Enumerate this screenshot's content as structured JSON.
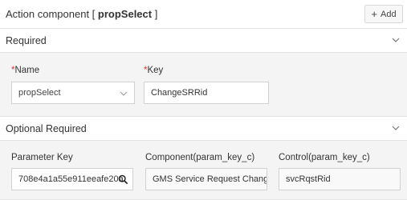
{
  "header": {
    "title_prefix": "Action component [ ",
    "title_name": "propSelect",
    "title_suffix": " ]",
    "add_label": "Add"
  },
  "required_section": {
    "label": "Required",
    "name_label": "Name",
    "name_value": "propSelect",
    "key_label": "Key",
    "key_value": "ChangeSRRid"
  },
  "optional_section": {
    "label": "Optional Required",
    "param_key_label": "Parameter Key",
    "param_key_value": "708e4a1a55e911eeafe20a",
    "component_label": "Component(param_key_c)",
    "component_value": "GMS Service Request Change",
    "control_label": "Control(param_key_c)",
    "control_value": "svcRqstRid"
  },
  "colors": {
    "required_asterisk": "#e0352b",
    "panel_bg": "#f4f4f4"
  }
}
